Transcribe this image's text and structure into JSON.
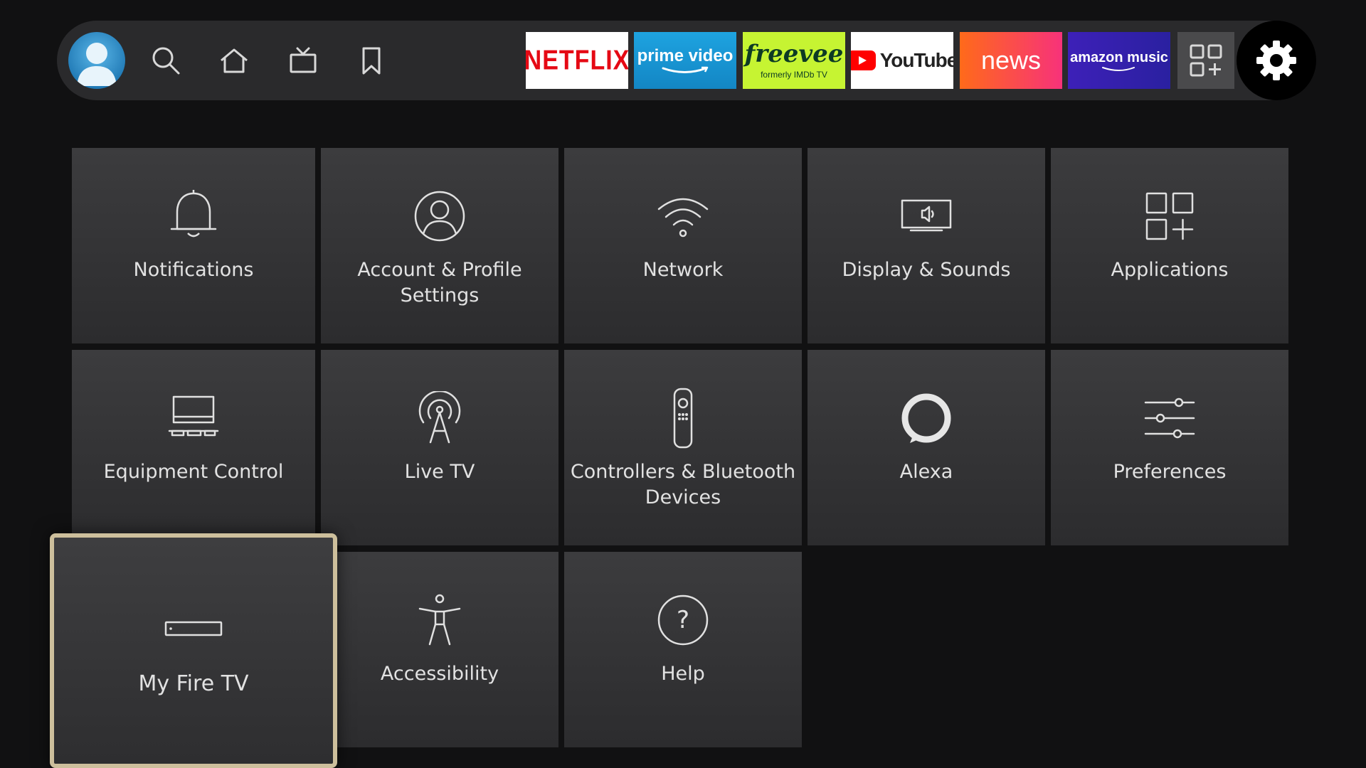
{
  "nav": {
    "icons": [
      "profile-avatar",
      "search-icon",
      "home-icon",
      "live-tv-icon",
      "bookmark-icon"
    ],
    "apps": [
      {
        "label": "NETFLIX",
        "bg": "#ffffff",
        "color": "#e50914"
      },
      {
        "label": "prime video",
        "bg": "#1a98d5",
        "color": "#ffffff"
      },
      {
        "label": "freevee",
        "sublabel": "formerly IMDb TV",
        "bg": "#c6f432",
        "color": "#0d3b24"
      },
      {
        "label": "YouTube",
        "bg": "#ffffff",
        "color": "#222222"
      },
      {
        "label": "news",
        "bg": "#ff5a1f",
        "color": "#ffffff"
      },
      {
        "label": "amazon music",
        "bg": "#3b1ea8",
        "color": "#ffffff"
      }
    ],
    "app_grid_icon": "apps-grid-icon",
    "settings_icon": "gear-icon"
  },
  "settings": {
    "tiles": [
      {
        "label": "Notifications",
        "icon": "bell-icon"
      },
      {
        "label": "Account & Profile Settings",
        "icon": "profile-icon"
      },
      {
        "label": "Network",
        "icon": "wifi-icon"
      },
      {
        "label": "Display & Sounds",
        "icon": "display-sound-icon"
      },
      {
        "label": "Applications",
        "icon": "applications-icon"
      },
      {
        "label": "Equipment Control",
        "icon": "equipment-icon"
      },
      {
        "label": "Live TV",
        "icon": "antenna-icon"
      },
      {
        "label": "Controllers & Bluetooth Devices",
        "icon": "remote-icon"
      },
      {
        "label": "Alexa",
        "icon": "alexa-icon"
      },
      {
        "label": "Preferences",
        "icon": "sliders-icon"
      },
      {
        "label": "My Fire TV",
        "icon": "fire-tv-device-icon",
        "focused": true
      },
      {
        "label": "Accessibility",
        "icon": "accessibility-icon"
      },
      {
        "label": "Help",
        "icon": "help-icon"
      }
    ]
  },
  "colors": {
    "background": "#111112",
    "nav_bar": "#2a2a2c",
    "tile": "#3c3c3e",
    "focus_border": "#cdbf9c"
  }
}
